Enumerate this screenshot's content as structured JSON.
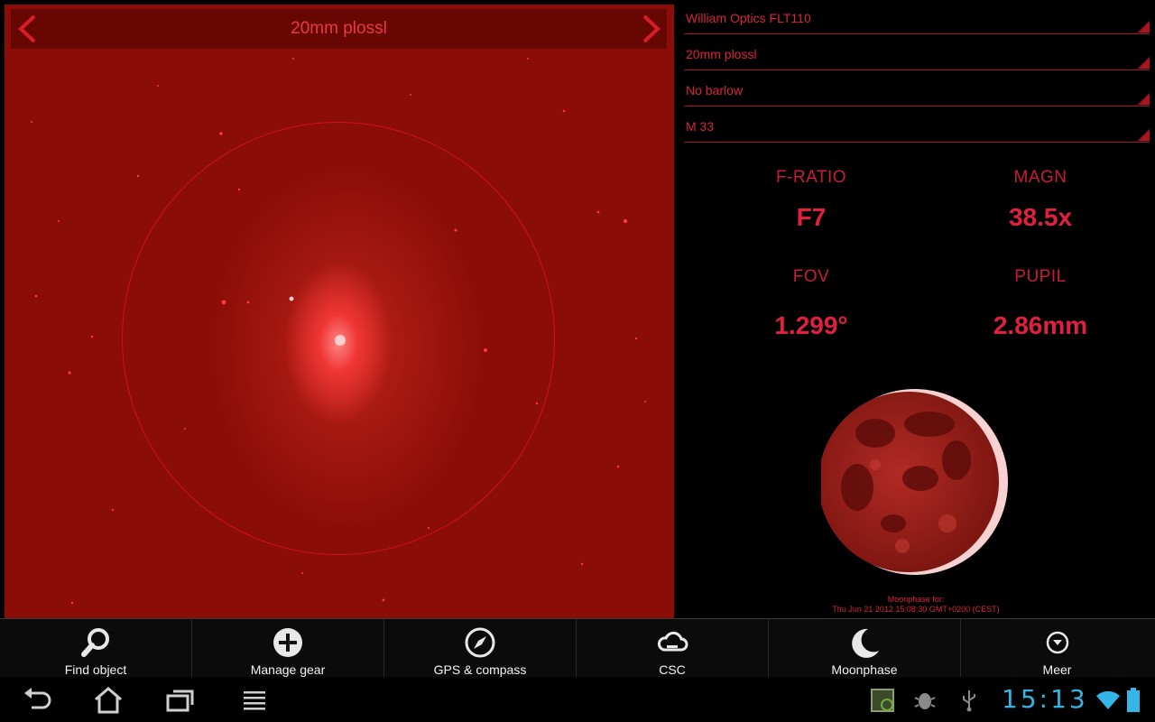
{
  "sky_view": {
    "eyepiece_title": "20mm plossl",
    "prev_label": "‹",
    "next_label": "›"
  },
  "gear": {
    "telescope": "William Optics FLT110",
    "eyepiece": "20mm plossl",
    "barlow": "No barlow",
    "target": "M 33"
  },
  "stats": {
    "f_ratio_label": "F-RATIO",
    "f_ratio_value": "F7",
    "magn_label": "MAGN",
    "magn_value": "38.5x",
    "fov_label": "FOV",
    "fov_value": "1.299°",
    "pupil_label": "PUPIL",
    "pupil_value": "2.86mm"
  },
  "moonphase": {
    "caption_title": "Moonphase for:",
    "caption_date": "Thu Jun 21 2012 15:08:30 GMT+0200 (CEST)"
  },
  "actions": [
    {
      "label": "Find object",
      "icon": "search-icon"
    },
    {
      "label": "Manage gear",
      "icon": "add-circle-icon"
    },
    {
      "label": "GPS & compass",
      "icon": "compass-icon"
    },
    {
      "label": "CSC",
      "icon": "cloud-icon"
    },
    {
      "label": "Moonphase",
      "icon": "moon-icon"
    },
    {
      "label": "Meer",
      "icon": "overflow-icon"
    }
  ],
  "system": {
    "clock": "15:13"
  },
  "colors": {
    "accent": "#d8243a",
    "sky": "#8a0e07",
    "clock": "#33b5e5"
  }
}
